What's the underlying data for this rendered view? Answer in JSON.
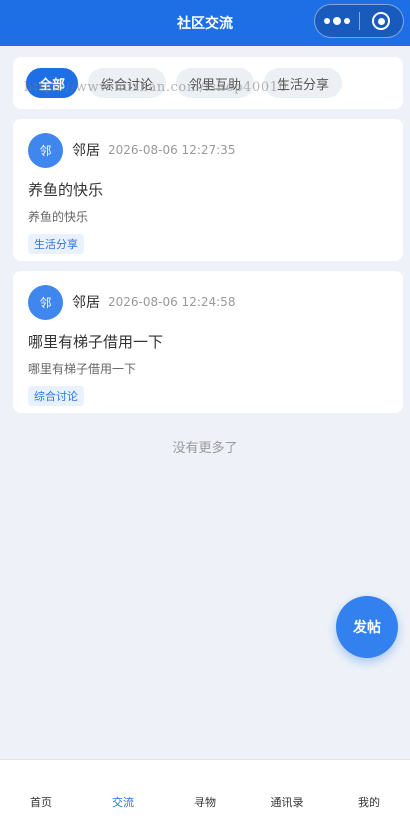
{
  "header": {
    "title": "社区交流"
  },
  "tabs": [
    {
      "label": "全部",
      "active": true
    },
    {
      "label": "综合讨论",
      "active": false
    },
    {
      "label": "邻里互助",
      "active": false
    },
    {
      "label": "生活分享",
      "active": false
    }
  ],
  "watermark": "https://www.huzhan.com/ishop40010",
  "posts": [
    {
      "avatar": "邻",
      "author": "邻居",
      "time": "2026-08-06 12:27:35",
      "title": "养鱼的快乐",
      "body": "养鱼的快乐",
      "tag": "生活分享"
    },
    {
      "avatar": "邻",
      "author": "邻居",
      "time": "2026-08-06 12:24:58",
      "title": "哪里有梯子借用一下",
      "body": "哪里有梯子借用一下",
      "tag": "综合讨论"
    }
  ],
  "no_more": "没有更多了",
  "fab_label": "发帖",
  "tabbar": [
    {
      "label": "首页",
      "active": false
    },
    {
      "label": "交流",
      "active": true
    },
    {
      "label": "寻物",
      "active": false
    },
    {
      "label": "通讯录",
      "active": false
    },
    {
      "label": "我的",
      "active": false
    }
  ],
  "colors": {
    "primary": "#1e6fe6",
    "background": "#eef2f8"
  }
}
